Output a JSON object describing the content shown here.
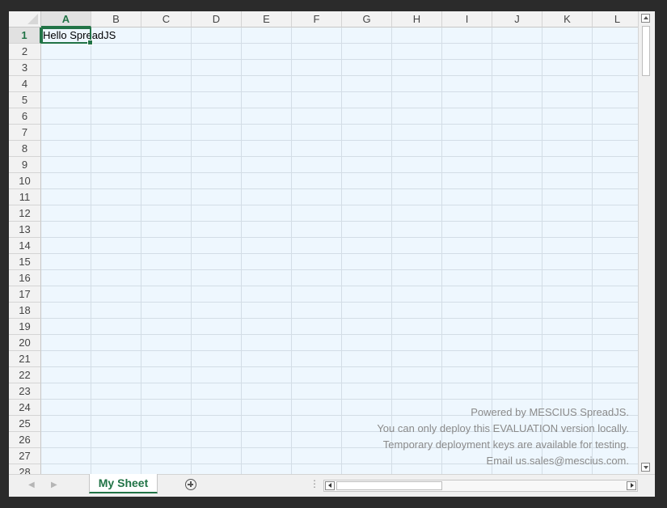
{
  "spreadsheet": {
    "columns": [
      "A",
      "B",
      "C",
      "D",
      "E",
      "F",
      "G",
      "H",
      "I",
      "J",
      "K",
      "L"
    ],
    "rows": [
      "1",
      "2",
      "3",
      "4",
      "5",
      "6",
      "7",
      "8",
      "9",
      "10",
      "11",
      "12",
      "13",
      "14",
      "15",
      "16",
      "17",
      "18",
      "19",
      "20",
      "21",
      "22",
      "23",
      "24",
      "25",
      "26",
      "27",
      "28"
    ],
    "selected_column": "A",
    "selected_row": "1",
    "cell_a1_value": "Hello SpreadJS"
  },
  "watermark": {
    "line1": "Powered by MESCIUS SpreadJS.",
    "line2": "You can only deploy this EVALUATION version locally.",
    "line3": "Temporary deployment keys are available for testing.",
    "line4": "Email us.sales@mescius.com."
  },
  "tabbar": {
    "sheet_tab_label": "My Sheet",
    "nav_prev_icon": "◀",
    "nav_next_icon": "▶",
    "splitter_icon": "⋮"
  },
  "colors": {
    "accent": "#217346",
    "cell_background": "#eef7fe"
  }
}
